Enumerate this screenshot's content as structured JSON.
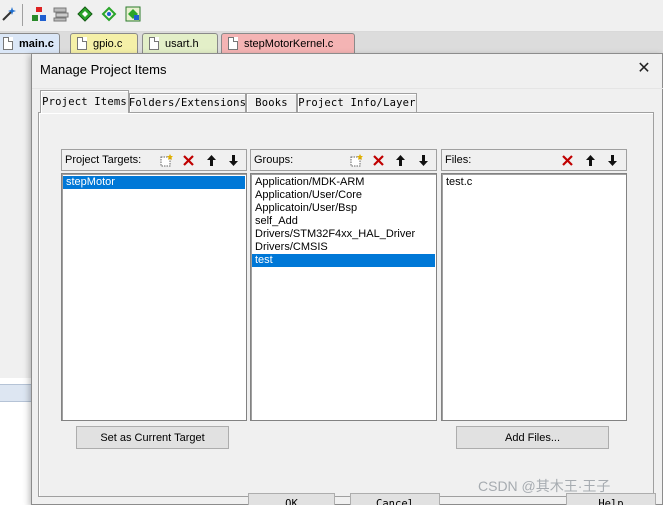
{
  "dialog": {
    "title": "Manage Project Items",
    "tabs": [
      {
        "label": "Project Items",
        "active": true
      },
      {
        "label": "Folders/Extensions",
        "active": false
      },
      {
        "label": "Books",
        "active": false
      },
      {
        "label": "Project Info/Layer",
        "active": false
      }
    ],
    "targets": {
      "label": "Project Targets:",
      "items": [
        "stepMotor"
      ],
      "selected_index": 0,
      "set_current_label": "Set as Current Target"
    },
    "groups": {
      "label": "Groups:",
      "items": [
        "Application/MDK-ARM",
        "Application/User/Core",
        "Applicatoin/User/Bsp",
        "self_Add",
        "Drivers/STM32F4xx_HAL_Driver",
        "Drivers/CMSIS",
        "test"
      ],
      "selected_index": 6
    },
    "files": {
      "label": "Files:",
      "items": [
        "test.c"
      ],
      "add_files_label": "Add Files..."
    },
    "footer": {
      "ok_label": "OK",
      "cancel_label": "Cancel",
      "help_label": "Help"
    }
  },
  "editor_tabs": [
    "main.c",
    "gpio.c",
    "usart.h",
    "stepMotorKernel.c"
  ],
  "watermark": "CSDN @其木王·王子",
  "colors": {
    "selection": "#0078d7",
    "delete_red": "#c00000",
    "tab_main": "#dbe7f7",
    "tab_gpio": "#f5f0a8",
    "tab_usart": "#e3efc8",
    "tab_kernel": "#f4b4b4"
  }
}
